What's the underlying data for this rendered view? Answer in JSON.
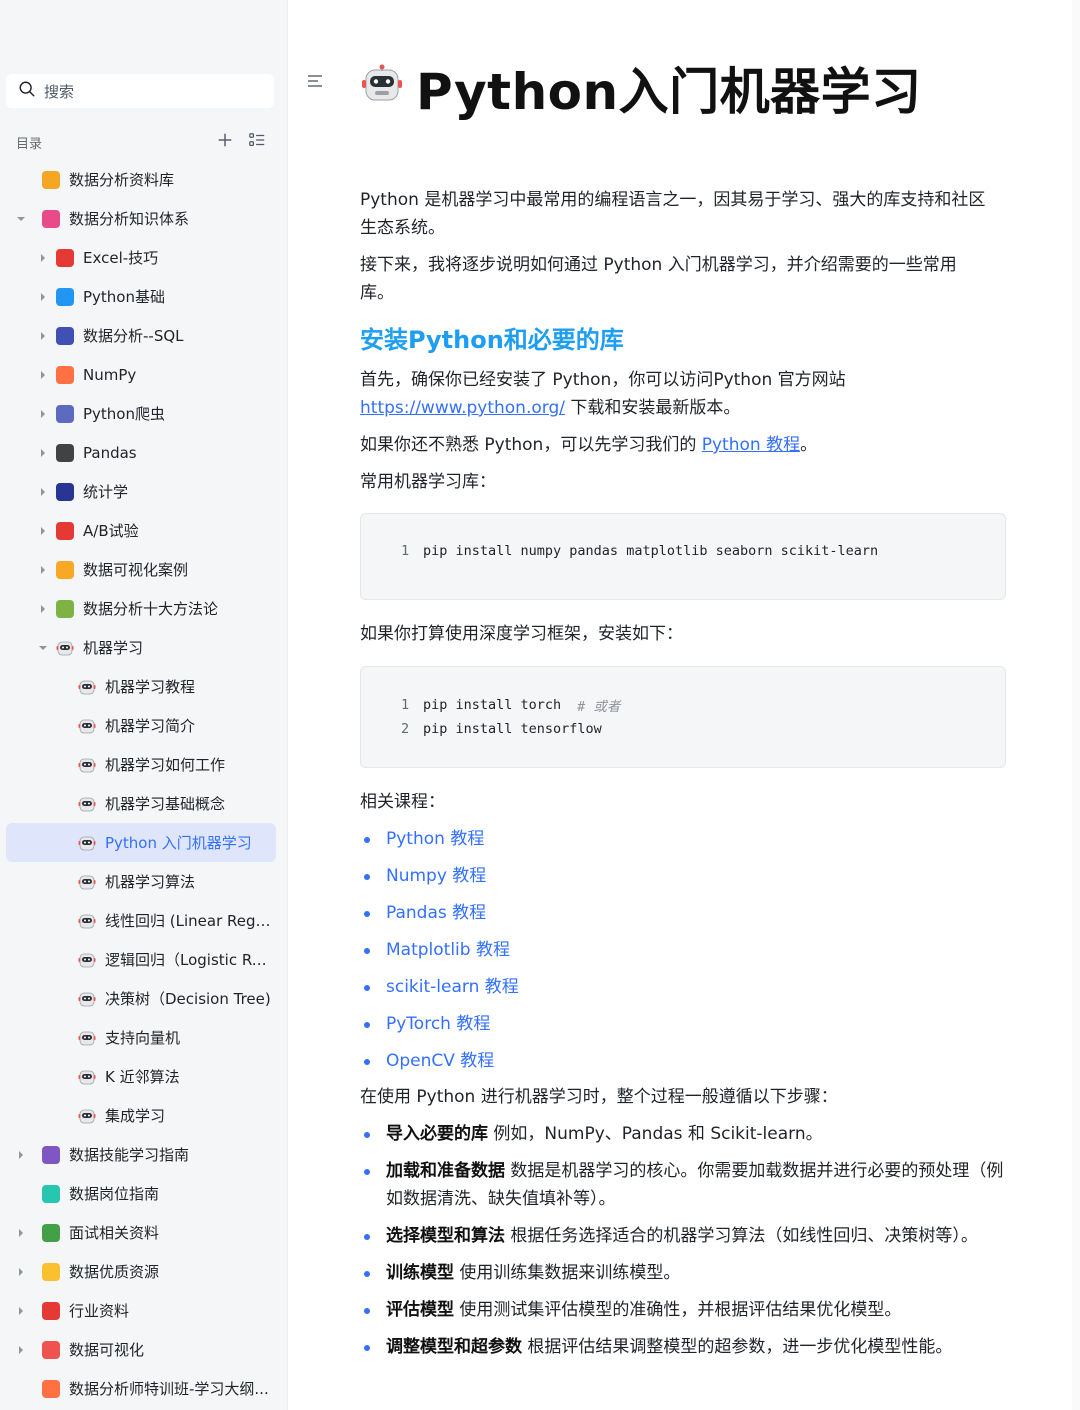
{
  "sidebar": {
    "search_placeholder": "搜索",
    "toc_label": "目录",
    "items": [
      {
        "label": "数据分析资料库",
        "level": 1,
        "caret": "none",
        "icon": "orange-folder-icon",
        "color": "#f5a623"
      },
      {
        "label": "数据分析知识体系",
        "level": 1,
        "caret": "down",
        "icon": "pink-box-icon",
        "color": "#e84a8a"
      },
      {
        "label": "Excel-技巧",
        "level": 2,
        "caret": "right",
        "icon": "hundred-points-icon",
        "color": "#e53935"
      },
      {
        "label": "Python基础",
        "level": 2,
        "caret": "right",
        "icon": "monitor-icon",
        "color": "#2196f3"
      },
      {
        "label": "数据分析--SQL",
        "level": 2,
        "caret": "right",
        "icon": "bar-chart-icon",
        "color": "#3f51b5"
      },
      {
        "label": "NumPy",
        "level": 2,
        "caret": "right",
        "icon": "memo-icon",
        "color": "#ff7043"
      },
      {
        "label": "Python爬虫",
        "level": 2,
        "caret": "right",
        "icon": "satellite-icon",
        "color": "#5c6bc0"
      },
      {
        "label": "Pandas",
        "level": 2,
        "caret": "right",
        "icon": "panda-icon",
        "color": "#424242"
      },
      {
        "label": "统计学",
        "level": 2,
        "caret": "right",
        "icon": "floppy-disk-icon",
        "color": "#283593"
      },
      {
        "label": "A/B试验",
        "level": 2,
        "caret": "right",
        "icon": "ab-button-icon",
        "color": "#e53935"
      },
      {
        "label": "数据可视化案例",
        "level": 2,
        "caret": "right",
        "icon": "medal-icon",
        "color": "#f9a825"
      },
      {
        "label": "数据分析十大方法论",
        "level": 2,
        "caret": "right",
        "icon": "puzzle-icon",
        "color": "#7cb342"
      },
      {
        "label": "机器学习",
        "level": 2,
        "caret": "down",
        "icon": "robot-icon",
        "color": "#757575"
      },
      {
        "label": "机器学习教程",
        "level": 3,
        "caret": "none",
        "icon": "robot-icon",
        "color": "#757575"
      },
      {
        "label": "机器学习简介",
        "level": 3,
        "caret": "none",
        "icon": "robot-icon",
        "color": "#757575"
      },
      {
        "label": "机器学习如何工作",
        "level": 3,
        "caret": "none",
        "icon": "robot-icon",
        "color": "#757575"
      },
      {
        "label": "机器学习基础概念",
        "level": 3,
        "caret": "none",
        "icon": "robot-icon",
        "color": "#757575"
      },
      {
        "label": "Python 入门机器学习",
        "level": 3,
        "caret": "none",
        "icon": "robot-icon",
        "color": "#757575",
        "active": true
      },
      {
        "label": "机器学习算法",
        "level": 3,
        "caret": "none",
        "icon": "robot-icon",
        "color": "#757575"
      },
      {
        "label": "线性回归 (Linear Regre...",
        "level": 3,
        "caret": "none",
        "icon": "robot-icon",
        "color": "#757575"
      },
      {
        "label": "逻辑回归（Logistic Reg...",
        "level": 3,
        "caret": "none",
        "icon": "robot-icon",
        "color": "#757575"
      },
      {
        "label": "决策树（Decision Tree)",
        "level": 3,
        "caret": "none",
        "icon": "robot-icon",
        "color": "#757575"
      },
      {
        "label": "支持向量机",
        "level": 3,
        "caret": "none",
        "icon": "robot-icon",
        "color": "#757575"
      },
      {
        "label": "K 近邻算法",
        "level": 3,
        "caret": "none",
        "icon": "robot-icon",
        "color": "#757575"
      },
      {
        "label": "集成学习",
        "level": 3,
        "caret": "none",
        "icon": "robot-icon",
        "color": "#757575"
      },
      {
        "label": "数据技能学习指南",
        "level": 1,
        "caret": "right",
        "icon": "purple-box-icon",
        "color": "#7e57c2"
      },
      {
        "label": "数据岗位指南",
        "level": 1,
        "caret": "none",
        "icon": "teal-box-icon",
        "color": "#26c6b0"
      },
      {
        "label": "面试相关资料",
        "level": 1,
        "caret": "right",
        "icon": "green-box-icon",
        "color": "#43a047"
      },
      {
        "label": "数据优质资源",
        "level": 1,
        "caret": "right",
        "icon": "thumbs-up-icon",
        "color": "#fbc02d"
      },
      {
        "label": "行业资料",
        "level": 1,
        "caret": "right",
        "icon": "tear-off-calendar-icon",
        "color": "#e53935"
      },
      {
        "label": "数据可视化",
        "level": 1,
        "caret": "right",
        "icon": "rocket-icon",
        "color": "#ef5350"
      },
      {
        "label": "数据分析师特训班-学习大纲...",
        "level": 1,
        "caret": "none",
        "icon": "memo-icon",
        "color": "#ff7043"
      }
    ]
  },
  "document": {
    "title": "Python入门机器学习",
    "title_icon": "robot-face-icon",
    "intro_1": "Python 是机器学习中最常用的编程语言之一，因其易于学习、强大的库支持和社区生态系统。",
    "intro_1a": "Python 是机器学习中最常用的编程语言之一，因其易于学习、强大的库支持和社区",
    "intro_1b": "生态系统。",
    "intro_2a": "接下来，我将逐步说明如何通过 Python 入门机器学习，并介绍需要的一些常用",
    "intro_2b": "库。",
    "section_heading": "安装Python和必要的库",
    "install_p1a": "首先，确保你已经安装了 Python，你可以访问Python 官方网站",
    "install_url": "https://www.python.org/",
    "install_p1b": " 下载和安装最新版本。",
    "install_p2a": "如果你还不熟悉 Python，可以先学习我们的 ",
    "install_p2_link": "Python 教程",
    "install_p2b": "。",
    "libs_label": "常用机器学习库：",
    "code_1": [
      {
        "n": "1",
        "code": "pip install numpy pandas matplotlib seaborn scikit-learn",
        "comment": ""
      }
    ],
    "dl_label": "如果你打算使用深度学习框架，安装如下：",
    "code_2": [
      {
        "n": "1",
        "code": "pip install torch",
        "comment": "# 或者"
      },
      {
        "n": "2",
        "code": "pip install tensorflow",
        "comment": ""
      }
    ],
    "courses_label": "相关课程：",
    "courses": [
      "Python 教程",
      "Numpy 教程",
      "Pandas 教程",
      "Matplotlib 教程",
      "scikit-learn 教程",
      "PyTorch 教程",
      "OpenCV 教程"
    ],
    "steps_intro": "在使用 Python 进行机器学习时，整个过程一般遵循以下步骤：",
    "steps": [
      {
        "bold": "导入必要的库",
        "text": " 例如，NumPy、Pandas 和 Scikit-learn。"
      },
      {
        "bold": "加载和准备数据",
        "text": " 数据是机器学习的核心。你需要加载数据并进行必要的预处理（例如数据清洗、缺失值填补等）。"
      },
      {
        "bold": "选择模型和算法",
        "text": " 根据任务选择适合的机器学习算法（如线性回归、决策树等）。"
      },
      {
        "bold": "训练模型",
        "text": " 使用训练集数据来训练模型。"
      },
      {
        "bold": "评估模型",
        "text": " 使用测试集评估模型的准确性，并根据评估结果优化模型。"
      },
      {
        "bold": "调整模型和超参数",
        "text": " 根据评估结果调整模型的超参数，进一步优化模型性能。"
      }
    ]
  },
  "colors": {
    "accent": "#3370ff",
    "heading": "#1e9ef0",
    "active_bg": "#dfe6fb"
  }
}
